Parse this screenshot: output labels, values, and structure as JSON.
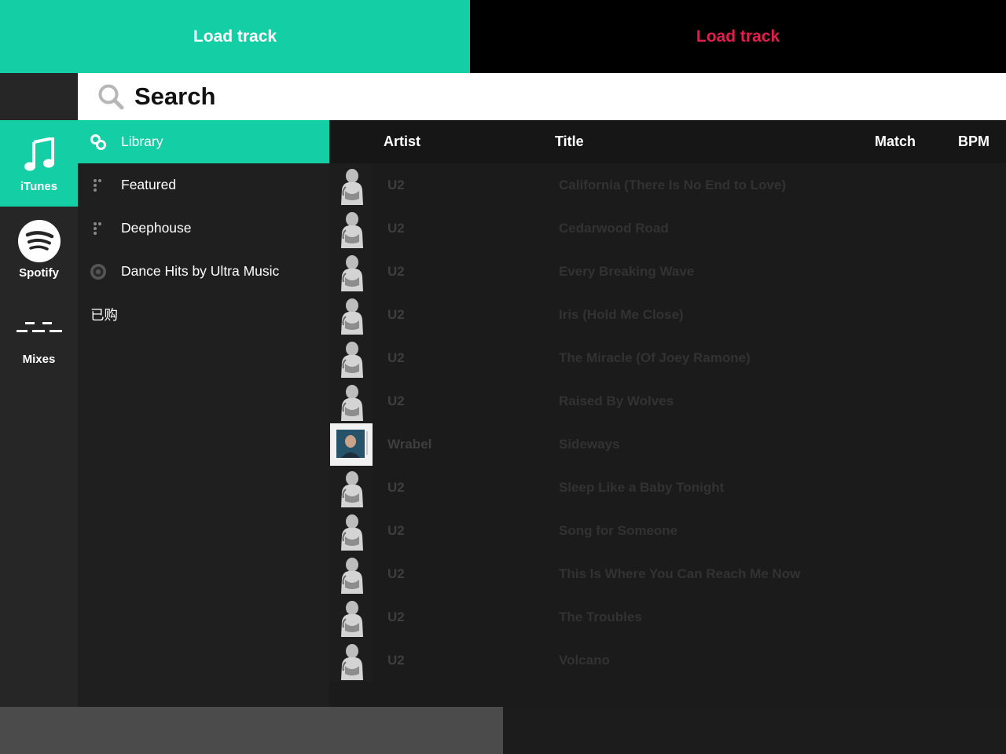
{
  "decks": {
    "left_label": "Load track",
    "right_label": "Load track",
    "left_color": "#14cea6",
    "right_text_color": "#e01e4f"
  },
  "search": {
    "placeholder": "Search",
    "value": ""
  },
  "sources": [
    {
      "label": "iTunes",
      "icon": "music-note-icon",
      "active": true
    },
    {
      "label": "Spotify",
      "icon": "spotify-logo-icon",
      "active": false
    },
    {
      "label": "Mixes",
      "icon": "mixes-icon",
      "active": false
    }
  ],
  "playlists": [
    {
      "label": "Library",
      "icon": "link-icon",
      "active": true
    },
    {
      "label": "Featured",
      "icon": "dots-icon",
      "active": false
    },
    {
      "label": "Deephouse",
      "icon": "dots-icon",
      "active": false
    },
    {
      "label": "Dance Hits by Ultra Music",
      "icon": "gear-icon",
      "active": false
    },
    {
      "label": "已购",
      "icon": "",
      "active": false
    }
  ],
  "table": {
    "headers": {
      "artist": "Artist",
      "title": "Title",
      "match": "Match",
      "bpm": "BPM"
    },
    "rows": [
      {
        "artist": "U2",
        "title": "California (There Is No End to Love)",
        "art": "u2-cover"
      },
      {
        "artist": "U2",
        "title": "Cedarwood Road",
        "art": "u2-cover"
      },
      {
        "artist": "U2",
        "title": "Every Breaking Wave",
        "art": "u2-cover"
      },
      {
        "artist": "U2",
        "title": "Iris (Hold Me Close)",
        "art": "u2-cover"
      },
      {
        "artist": "U2",
        "title": "The Miracle (Of Joey Ramone)",
        "art": "u2-cover"
      },
      {
        "artist": "U2",
        "title": "Raised By Wolves",
        "art": "u2-cover"
      },
      {
        "artist": "Wrabel",
        "title": "Sideways",
        "art": "wrabel-cover"
      },
      {
        "artist": "U2",
        "title": "Sleep Like a Baby Tonight",
        "art": "u2-cover"
      },
      {
        "artist": "U2",
        "title": "Song for Someone",
        "art": "u2-cover"
      },
      {
        "artist": "U2",
        "title": "This Is Where You Can Reach Me Now",
        "art": "u2-cover"
      },
      {
        "artist": "U2",
        "title": "The Troubles",
        "art": "u2-cover"
      },
      {
        "artist": "U2",
        "title": "Volcano",
        "art": "u2-cover"
      }
    ]
  }
}
